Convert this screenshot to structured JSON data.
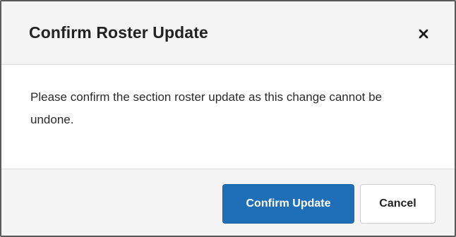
{
  "dialog": {
    "title": "Confirm Roster Update",
    "close_icon": "close-icon",
    "message": "Please confirm the section roster update as this change cannot be undone.",
    "buttons": {
      "confirm_label": "Confirm Update",
      "cancel_label": "Cancel"
    }
  },
  "colors": {
    "primary": "#1f6fb8",
    "header_bg": "#f4f4f4",
    "text": "#222222"
  }
}
